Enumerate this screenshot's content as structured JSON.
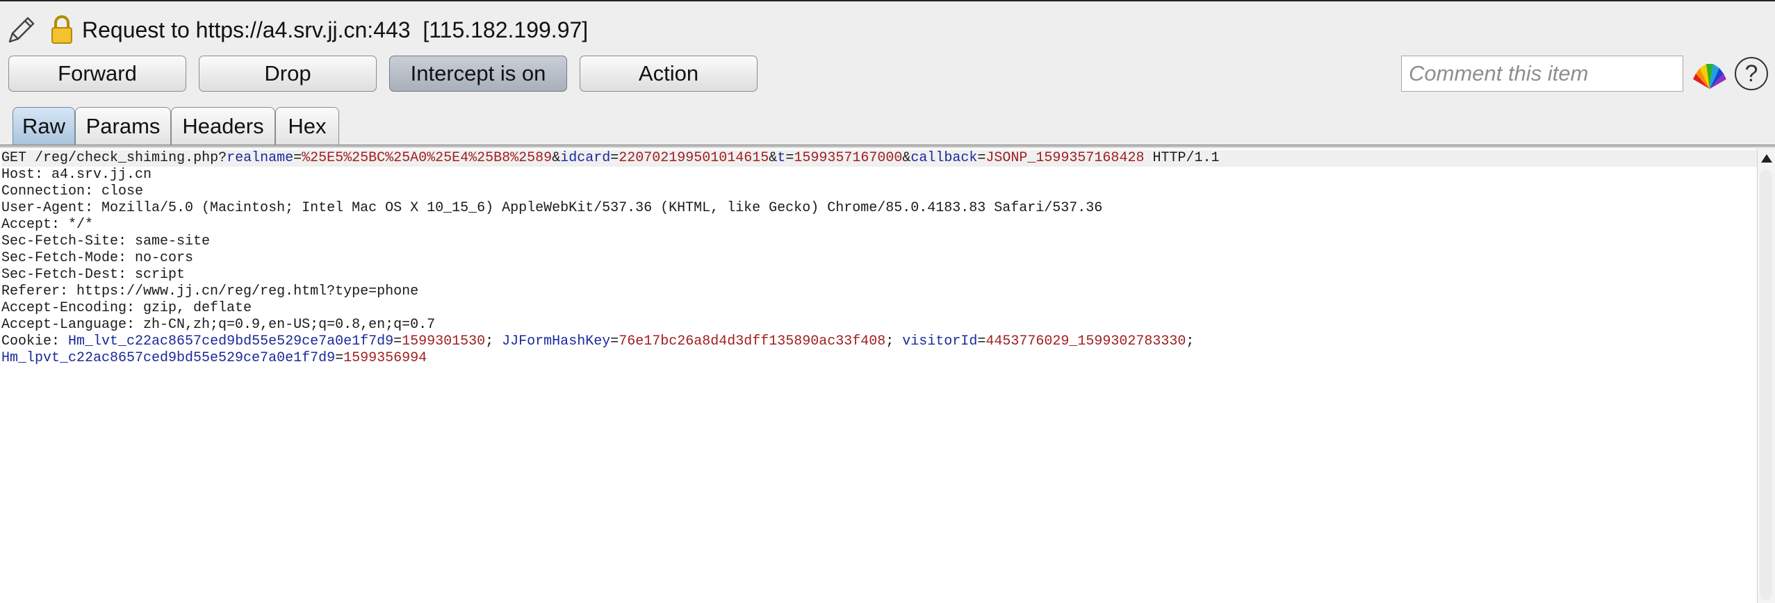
{
  "header": {
    "title": "Request to https://a4.srv.jj.cn:443  [115.182.199.97]",
    "edit_icon": "pencil-icon",
    "lock_icon": "lock-icon"
  },
  "toolbar": {
    "forward_label": "Forward",
    "drop_label": "Drop",
    "intercept_label": "Intercept is on",
    "action_label": "Action",
    "comment_placeholder": "Comment this item",
    "highlight_icon": "color-fan-icon",
    "help_label": "?"
  },
  "tabs": [
    {
      "label": "Raw",
      "active": true
    },
    {
      "label": "Params",
      "active": false
    },
    {
      "label": "Headers",
      "active": false
    },
    {
      "label": "Hex",
      "active": false
    }
  ],
  "request": {
    "method": "GET",
    "path": "/reg/check_shiming.php",
    "protocol": "HTTP/1.1",
    "query": [
      {
        "key": "realname",
        "value": "%25E5%25BC%25A0%25E4%25B8%2589"
      },
      {
        "key": "idcard",
        "value": "220702199501014615"
      },
      {
        "key": "t",
        "value": "1599357167000"
      },
      {
        "key": "callback",
        "value": "JSONP_1599357168428"
      }
    ],
    "headers": [
      "Host: a4.srv.jj.cn",
      "Connection: close",
      "User-Agent: Mozilla/5.0 (Macintosh; Intel Mac OS X 10_15_6) AppleWebKit/537.36 (KHTML, like Gecko) Chrome/85.0.4183.83 Safari/537.36",
      "Accept: */*",
      "Sec-Fetch-Site: same-site",
      "Sec-Fetch-Mode: no-cors",
      "Sec-Fetch-Dest: script",
      "Referer: https://www.jj.cn/reg/reg.html?type=phone",
      "Accept-Encoding: gzip, deflate",
      "Accept-Language: zh-CN,zh;q=0.9,en-US;q=0.8,en;q=0.7"
    ],
    "cookie_label": "Cookie:",
    "cookies": [
      {
        "key": "Hm_lvt_c22ac8657ced9bd55e529ce7a0e1f7d9",
        "value": "1599301530"
      },
      {
        "key": "JJFormHashKey",
        "value": "76e17bc26a8d4d3dff135890ac33f408"
      },
      {
        "key": "visitorId",
        "value": "4453776029_1599302783330"
      },
      {
        "key": "Hm_lpvt_c22ac8657ced9bd55e529ce7a0e1f7d9",
        "value": "1599356994"
      }
    ]
  },
  "colors": {
    "param_key": "#1a2a9a",
    "param_value": "#a02020",
    "active_tab": "#a9c4de"
  }
}
